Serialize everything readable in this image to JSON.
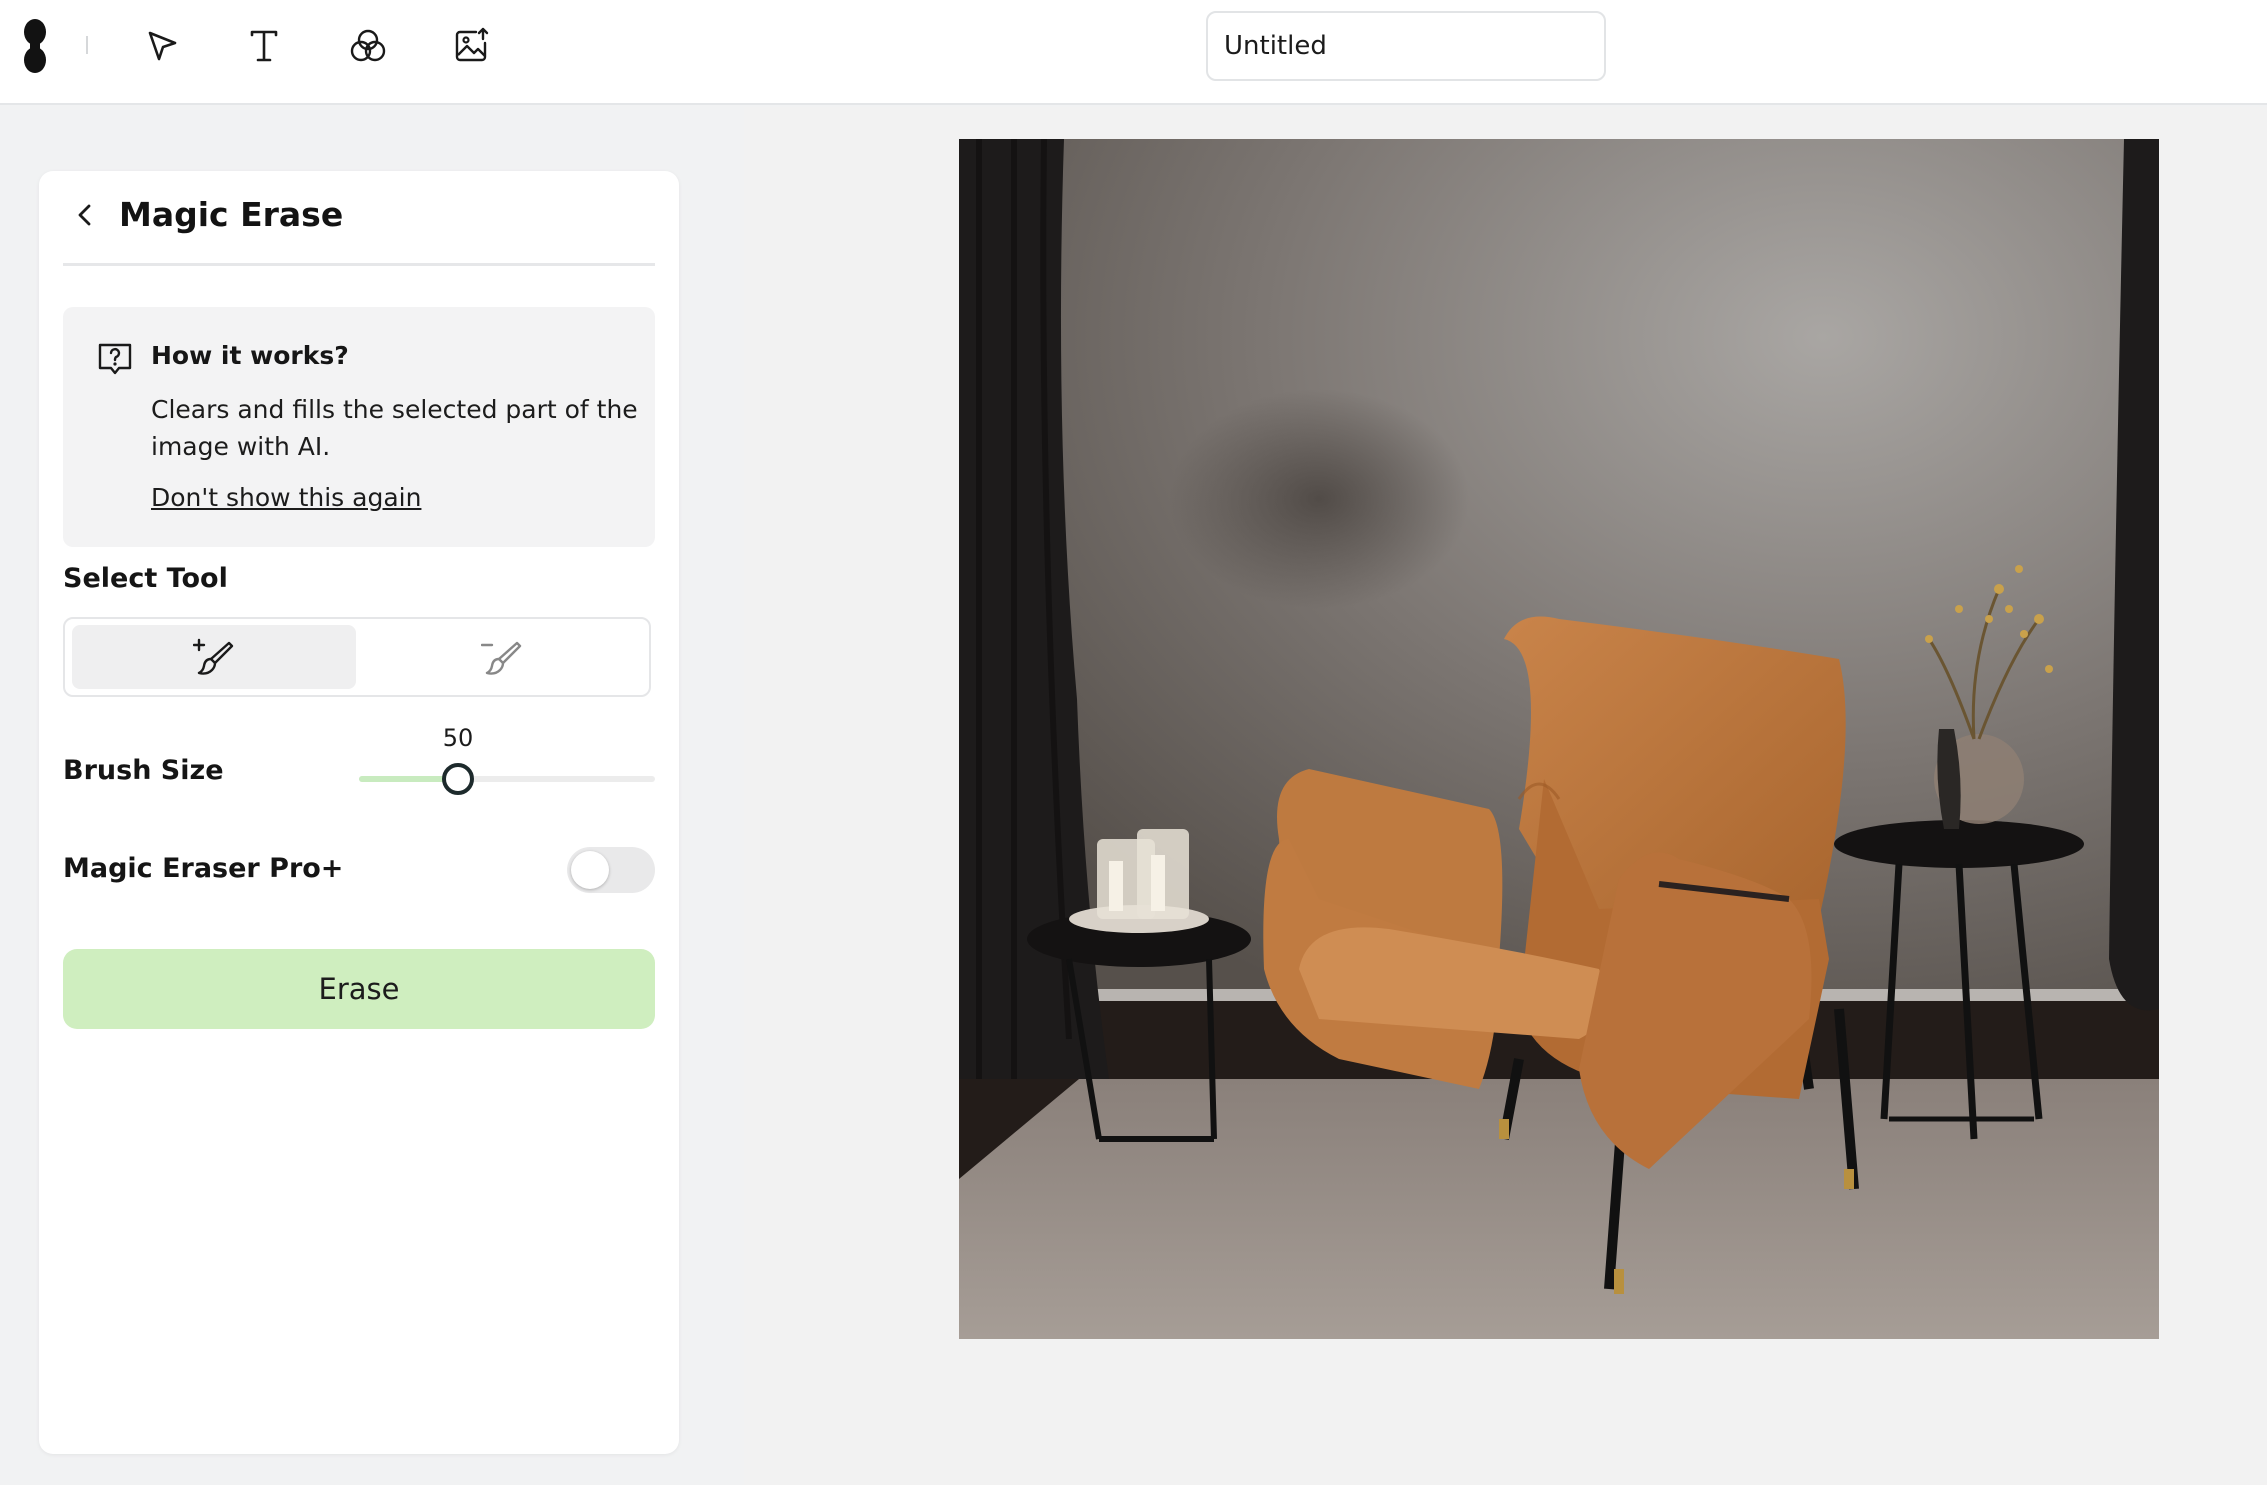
{
  "toolbar": {
    "logo_icon": "infinity-logo",
    "tools": [
      {
        "name": "select",
        "icon": "pointer-icon"
      },
      {
        "name": "text",
        "icon": "text-icon"
      },
      {
        "name": "effects",
        "icon": "circles-icon"
      },
      {
        "name": "upload-image",
        "icon": "image-upload-icon"
      }
    ],
    "document_title": "Untitled"
  },
  "panel": {
    "title": "Magic Erase",
    "info": {
      "title": "How it works?",
      "text": "Clears and fills the selected part of the image with AI.",
      "dismiss_link": "Don't show this again"
    },
    "select_tool": {
      "label": "Select Tool",
      "options": [
        {
          "name": "add-brush",
          "icon": "brush-plus-icon",
          "active": true
        },
        {
          "name": "remove-brush",
          "icon": "brush-minus-icon",
          "active": false
        }
      ]
    },
    "brush_size": {
      "label": "Brush Size",
      "value": "50",
      "min": 0,
      "max": 150
    },
    "pro": {
      "label": "Magic Eraser Pro+",
      "enabled": false
    },
    "erase_button": "Erase"
  },
  "colors": {
    "accent_green": "#cfeebf",
    "slider_fill": "#c8ebbf",
    "panel_bg": "#ffffff",
    "page_bg": "#f1f2f3"
  }
}
